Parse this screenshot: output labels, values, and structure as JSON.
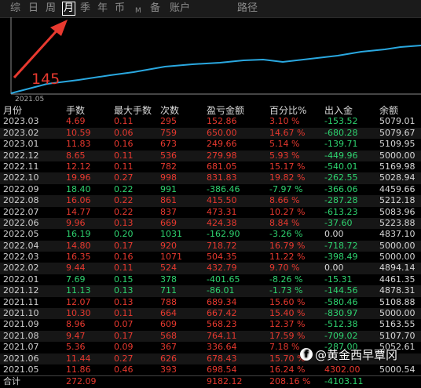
{
  "tabs": [
    {
      "label": "综"
    },
    {
      "label": "日"
    },
    {
      "label": "周"
    },
    {
      "label": "月"
    },
    {
      "label": "季"
    },
    {
      "label": "年"
    },
    {
      "label": "币"
    },
    {
      "label": "M"
    },
    {
      "label": "备"
    },
    {
      "label": "账户"
    },
    {
      "label": "路径"
    }
  ],
  "active_tab": "月",
  "chart": {
    "value_label": "145",
    "start_label": "2021.05",
    "line_color": "#2aa8e0",
    "arrow_color": "#e8392f"
  },
  "table": {
    "headers": [
      "月份",
      "手数",
      "最大手数",
      "次数",
      "盈亏金额",
      "百分比%",
      "出入金",
      "余额"
    ],
    "rows": [
      {
        "date": "2023.03",
        "lots": "4.69",
        "max_lots": "0.11",
        "count": "295",
        "pnl": "152.86",
        "pct": "3.10 %",
        "flow": "-153.52",
        "balance": "5079.01",
        "dir": "up"
      },
      {
        "date": "2023.02",
        "lots": "10.59",
        "max_lots": "0.06",
        "count": "759",
        "pnl": "650.00",
        "pct": "14.67 %",
        "flow": "-680.28",
        "balance": "5079.67",
        "dir": "up"
      },
      {
        "date": "2023.01",
        "lots": "11.83",
        "max_lots": "0.16",
        "count": "673",
        "pnl": "249.66",
        "pct": "5.14 %",
        "flow": "-139.71",
        "balance": "5109.95",
        "dir": "up"
      },
      {
        "date": "2022.12",
        "lots": "8.65",
        "max_lots": "0.11",
        "count": "536",
        "pnl": "279.98",
        "pct": "5.93 %",
        "flow": "-449.96",
        "balance": "5000.00",
        "dir": "up"
      },
      {
        "date": "2022.11",
        "lots": "12.12",
        "max_lots": "0.11",
        "count": "782",
        "pnl": "681.05",
        "pct": "15.17 %",
        "flow": "-540.01",
        "balance": "5169.98",
        "dir": "up"
      },
      {
        "date": "2022.10",
        "lots": "19.96",
        "max_lots": "0.27",
        "count": "998",
        "pnl": "831.83",
        "pct": "19.82 %",
        "flow": "-262.55",
        "balance": "5028.94",
        "dir": "up"
      },
      {
        "date": "2022.09",
        "lots": "18.40",
        "max_lots": "0.22",
        "count": "991",
        "pnl": "-386.46",
        "pct": "-7.97 %",
        "flow": "-366.06",
        "balance": "4459.66",
        "dir": "down"
      },
      {
        "date": "2022.08",
        "lots": "16.06",
        "max_lots": "0.22",
        "count": "861",
        "pnl": "415.50",
        "pct": "8.66 %",
        "flow": "-287.28",
        "balance": "5212.18",
        "dir": "up"
      },
      {
        "date": "2022.07",
        "lots": "14.77",
        "max_lots": "0.22",
        "count": "837",
        "pnl": "473.31",
        "pct": "10.27 %",
        "flow": "-613.23",
        "balance": "5083.96",
        "dir": "up"
      },
      {
        "date": "2022.06",
        "lots": "9.96",
        "max_lots": "0.13",
        "count": "669",
        "pnl": "424.38",
        "pct": "8.84 %",
        "flow": "-37.60",
        "balance": "5223.88",
        "dir": "up"
      },
      {
        "date": "2022.05",
        "lots": "16.19",
        "max_lots": "0.20",
        "count": "1031",
        "pnl": "-162.90",
        "pct": "-3.26 %",
        "flow": "0.00",
        "balance": "4837.10",
        "dir": "down"
      },
      {
        "date": "2022.04",
        "lots": "14.80",
        "max_lots": "0.17",
        "count": "920",
        "pnl": "718.72",
        "pct": "16.79 %",
        "flow": "-718.72",
        "balance": "5000.00",
        "dir": "up"
      },
      {
        "date": "2022.03",
        "lots": "16.35",
        "max_lots": "0.16",
        "count": "1071",
        "pnl": "504.35",
        "pct": "11.22 %",
        "flow": "-398.49",
        "balance": "5000.00",
        "dir": "up"
      },
      {
        "date": "2022.02",
        "lots": "9.44",
        "max_lots": "0.11",
        "count": "524",
        "pnl": "432.79",
        "pct": "9.70 %",
        "flow": "0.00",
        "balance": "4894.14",
        "dir": "up"
      },
      {
        "date": "2022.01",
        "lots": "7.69",
        "max_lots": "0.15",
        "count": "378",
        "pnl": "-401.65",
        "pct": "-8.26 %",
        "flow": "-15.31",
        "balance": "4461.35",
        "dir": "down"
      },
      {
        "date": "2021.12",
        "lots": "11.13",
        "max_lots": "0.13",
        "count": "711",
        "pnl": "-86.01",
        "pct": "-1.73 %",
        "flow": "-144.56",
        "balance": "4878.31",
        "dir": "down"
      },
      {
        "date": "2021.11",
        "lots": "12.07",
        "max_lots": "0.13",
        "count": "788",
        "pnl": "689.34",
        "pct": "15.60 %",
        "flow": "-580.46",
        "balance": "5108.88",
        "dir": "up"
      },
      {
        "date": "2021.10",
        "lots": "10.30",
        "max_lots": "0.11",
        "count": "664",
        "pnl": "667.42",
        "pct": "15.40 %",
        "flow": "-830.97",
        "balance": "5000.00",
        "dir": "up"
      },
      {
        "date": "2021.09",
        "lots": "8.96",
        "max_lots": "0.07",
        "count": "609",
        "pnl": "568.23",
        "pct": "12.37 %",
        "flow": "-512.38",
        "balance": "5163.55",
        "dir": "up"
      },
      {
        "date": "2021.08",
        "lots": "9.47",
        "max_lots": "0.17",
        "count": "568",
        "pnl": "764.11",
        "pct": "17.59 %",
        "flow": "-709.02",
        "balance": "5107.70",
        "dir": "up"
      },
      {
        "date": "2021.07",
        "lots": "5.36",
        "max_lots": "0.09",
        "count": "367",
        "pnl": "336.64",
        "pct": "7.18 %",
        "flow": "-287.00",
        "balance": "5052.61",
        "dir": "up"
      },
      {
        "date": "2021.06",
        "lots": "11.44",
        "max_lots": "0.27",
        "count": "626",
        "pnl": "678.43",
        "pct": "15.70 %",
        "flow": "",
        "balance": "",
        "dir": "up"
      },
      {
        "date": "2021.05",
        "lots": "11.86",
        "max_lots": "0.46",
        "count": "393",
        "pnl": "698.54",
        "pct": "16.24 %",
        "flow": "4302.00",
        "balance": "5000.54",
        "dir": "up"
      }
    ],
    "total": {
      "label": "合计",
      "lots": "272.09",
      "pnl": "9182.12",
      "pct": "208.16 %",
      "flow": "-4103.11"
    }
  },
  "watermark": {
    "logo": "f",
    "handle": "@黄金西早覃冈"
  },
  "colors": {
    "up": "#e8392f",
    "down": "#2ed36f",
    "background": "#000000"
  }
}
